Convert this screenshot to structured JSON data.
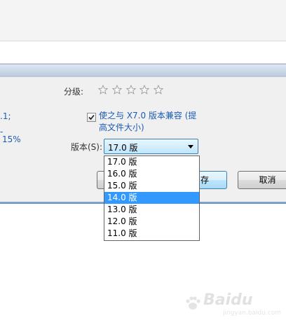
{
  "dialog": {
    "rating_label": "分级:",
    "stars_count": 5,
    "compat_checkbox": {
      "checked": true,
      "line1": "使之与 X7.0 版本兼容 (提",
      "line2": "高文件大小)"
    },
    "left_clipped": [
      ".1;",
      "-",
      " 15%"
    ],
    "version_label": "版本(S):",
    "version_combo_value": "17.0 版",
    "version_options": [
      "17.0 版",
      "16.0 版",
      "15.0 版",
      "14.0 版",
      "13.0 版",
      "12.0 版",
      "11.0 版"
    ],
    "highlighted_option": "14.0 版",
    "buttons": {
      "save_partial": "存",
      "cancel": "取消"
    }
  },
  "watermark": {
    "brand": "Baidu",
    "sub": "jingyan.baidu.com"
  },
  "colors": {
    "link_blue": "#1a5bb5",
    "selection_blue": "#3399ff",
    "accent_border": "#3c7fb1"
  }
}
